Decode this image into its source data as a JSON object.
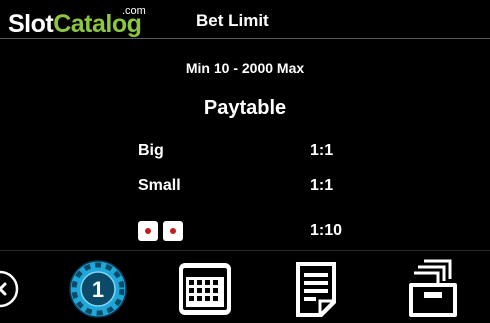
{
  "header": {
    "logo": {
      "slot": "Slot",
      "catalog": "Catalog",
      "tld": ".com"
    },
    "title": "Bet Limit"
  },
  "bet_limit": {
    "text": "Min 10 - 2000 Max"
  },
  "paytable": {
    "title": "Paytable",
    "rows": [
      {
        "label": "Big",
        "payout": "1:1"
      },
      {
        "label": "Small",
        "payout": "1:1"
      },
      {
        "icon": "double-one-dice-icon",
        "payout": "1:10"
      }
    ]
  },
  "footer": {
    "buttons": [
      {
        "icon": "close-icon"
      },
      {
        "icon": "chip-icon",
        "value": "1"
      },
      {
        "icon": "grid-calendar-icon"
      },
      {
        "icon": "document-icon"
      },
      {
        "icon": "archive-box-icon"
      }
    ]
  },
  "colors": {
    "background": "#000000",
    "logo_accent": "#8dc63f",
    "chip_blue": "#1ea7d8",
    "pip_red": "#c41e1e",
    "text": "#ffffff"
  }
}
